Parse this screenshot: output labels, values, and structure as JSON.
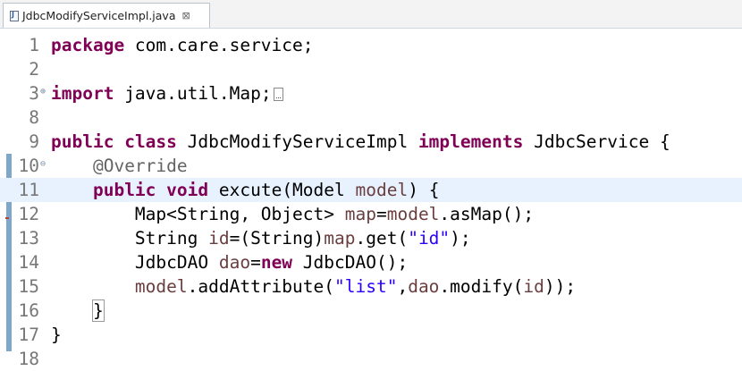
{
  "tab": {
    "title": "JdbcModifyServiceImpl.java",
    "close_glyph": "⊠",
    "icon": "java-file-icon"
  },
  "lines": [
    {
      "num": "1",
      "tokens": [
        {
          "t": "package",
          "c": "kw"
        },
        {
          "t": " com.care.service;"
        }
      ]
    },
    {
      "num": "2",
      "tokens": []
    },
    {
      "num": "3",
      "fold": "⊕",
      "folded": true,
      "tokens": [
        {
          "t": "import",
          "c": "kw"
        },
        {
          "t": " java.util.Map;"
        }
      ]
    },
    {
      "num": "8",
      "tokens": []
    },
    {
      "num": "9",
      "tokens": [
        {
          "t": "public",
          "c": "kw"
        },
        {
          "t": " "
        },
        {
          "t": "class",
          "c": "kw"
        },
        {
          "t": " JdbcModifyServiceImpl "
        },
        {
          "t": "implements",
          "c": "kw"
        },
        {
          "t": " JdbcService {"
        }
      ]
    },
    {
      "num": "10",
      "fold": "⊖",
      "tokens": [
        {
          "t": "    "
        },
        {
          "t": "@Override",
          "c": "ann"
        }
      ]
    },
    {
      "num": "11",
      "current": true,
      "tokens": [
        {
          "t": "    "
        },
        {
          "t": "public",
          "c": "kw"
        },
        {
          "t": " "
        },
        {
          "t": "void",
          "c": "kw"
        },
        {
          "t": " excute(Model "
        },
        {
          "t": "model",
          "c": "var"
        },
        {
          "t": ") {"
        }
      ]
    },
    {
      "num": "12",
      "tokens": [
        {
          "t": "        Map<String, Object> "
        },
        {
          "t": "map",
          "c": "var"
        },
        {
          "t": "="
        },
        {
          "t": "model",
          "c": "var"
        },
        {
          "t": ".asMap();"
        }
      ]
    },
    {
      "num": "13",
      "tokens": [
        {
          "t": "        String "
        },
        {
          "t": "id",
          "c": "var"
        },
        {
          "t": "=(String)"
        },
        {
          "t": "map",
          "c": "var"
        },
        {
          "t": ".get("
        },
        {
          "t": "\"id\"",
          "c": "str"
        },
        {
          "t": ");"
        }
      ]
    },
    {
      "num": "14",
      "tokens": [
        {
          "t": "        JdbcDAO "
        },
        {
          "t": "dao",
          "c": "var"
        },
        {
          "t": "="
        },
        {
          "t": "new",
          "c": "kw"
        },
        {
          "t": " JdbcDAO();"
        }
      ]
    },
    {
      "num": "15",
      "tokens": [
        {
          "t": "        "
        },
        {
          "t": "model",
          "c": "var"
        },
        {
          "t": ".addAttribute("
        },
        {
          "t": "\"list\"",
          "c": "str"
        },
        {
          "t": ","
        },
        {
          "t": "dao",
          "c": "var"
        },
        {
          "t": ".modify("
        },
        {
          "t": "id",
          "c": "var"
        },
        {
          "t": "));"
        }
      ]
    },
    {
      "num": "16",
      "tokens": [
        {
          "t": "    "
        },
        {
          "t": "}",
          "c": "brace"
        }
      ]
    },
    {
      "num": "17",
      "tokens": [
        {
          "t": "}"
        }
      ]
    },
    {
      "num": "18",
      "tokens": []
    }
  ]
}
